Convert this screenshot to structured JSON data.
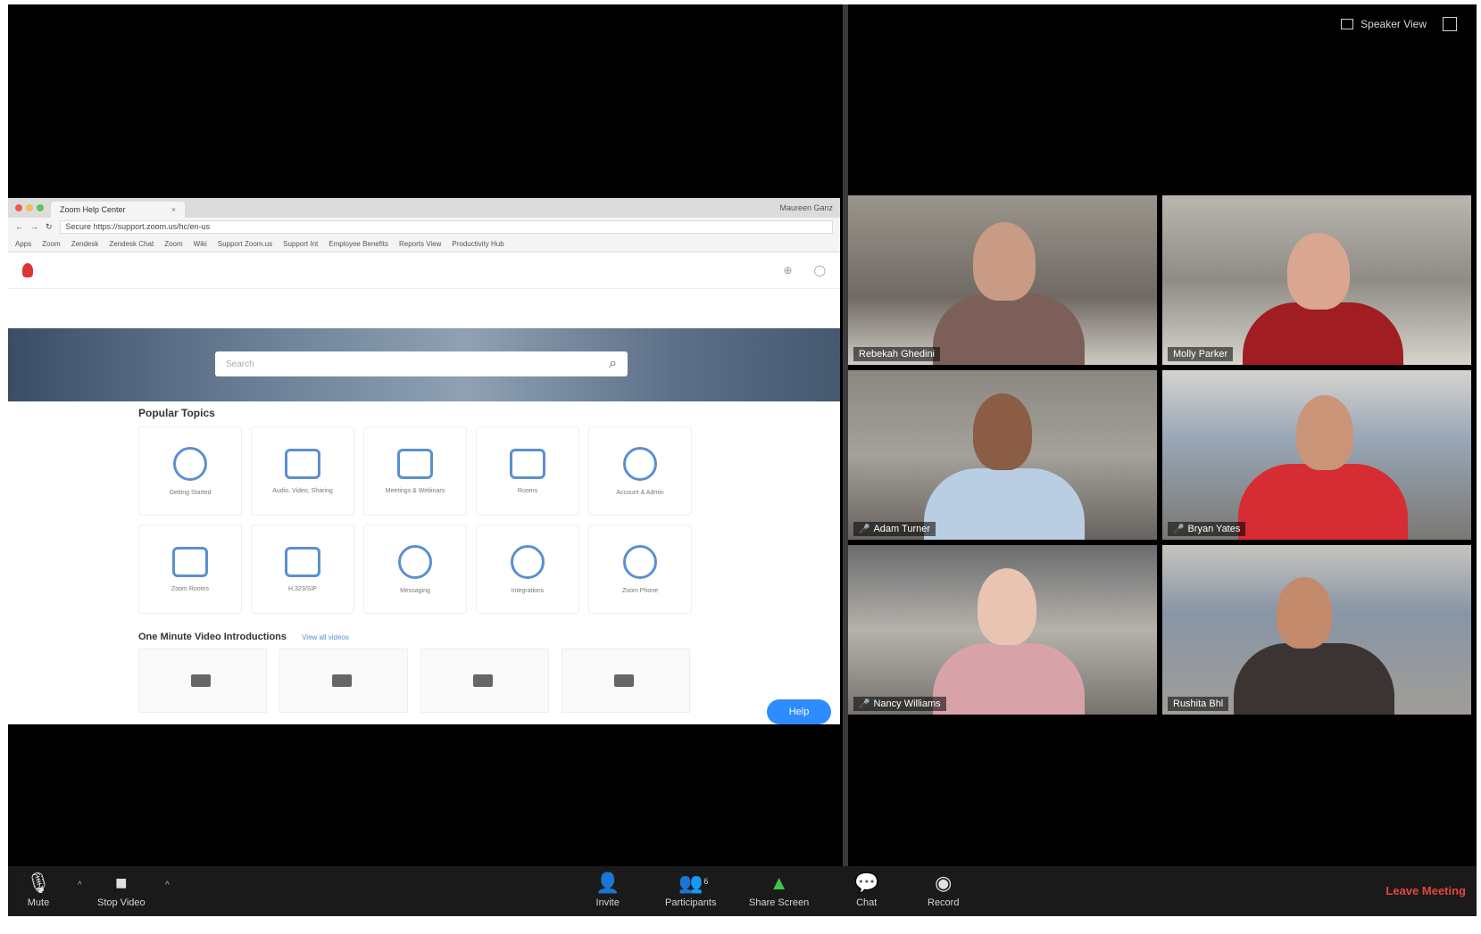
{
  "window": {
    "view_toggle_label": "Speaker View"
  },
  "shared_screen": {
    "tab_title": "Zoom Help Center",
    "user_name": "Maureen Ganz",
    "url": "Secure  https://support.zoom.us/hc/en-us",
    "bookmarks": [
      "Apps",
      "Zoom",
      "Zendesk",
      "Zendesk Chat",
      "Zoom",
      "Wiki",
      "Support Zoom.us",
      "Support Int",
      "Employee Benefits",
      "Reports View",
      "Productivity Hub"
    ],
    "search_placeholder": "Search",
    "popular_topics_title": "Popular Topics",
    "topics": [
      "Getting Started",
      "Audio, Video, Sharing",
      "Meetings & Webinars",
      "Rooms",
      "Account & Admin",
      "Zoom Rooms",
      "H.323/SIP",
      "Messaging",
      "Integrations",
      "Zoom Phone"
    ],
    "videos_title": "One Minute Video Introductions",
    "view_all_label": "View all videos",
    "help_button": "Help"
  },
  "participants": [
    {
      "name": "Rebekah Ghedini"
    },
    {
      "name": "Molly Parker"
    },
    {
      "name": "Adam Turner"
    },
    {
      "name": "Bryan Yates"
    },
    {
      "name": "Nancy Williams"
    },
    {
      "name": "Rushita Bhl"
    }
  ],
  "toolbar": {
    "mute": "Mute",
    "stop_video": "Stop Video",
    "invite": "Invite",
    "participants": "Participants",
    "participants_count": "6",
    "share_screen": "Share Screen",
    "chat": "Chat",
    "record": "Record",
    "leave_meeting": "Leave Meeting"
  },
  "colors": {
    "active_speaker_border": "#b4cc5c",
    "leave": "#e2463e",
    "share_green": "#3ec44a",
    "help_blue": "#2d8cff"
  }
}
